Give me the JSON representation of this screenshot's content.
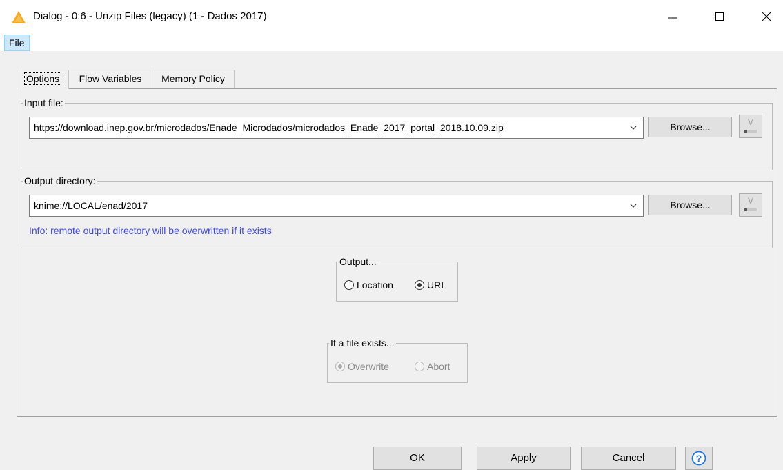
{
  "window": {
    "title": "Dialog - 0:6 - Unzip Files (legacy) (1 - Dados 2017)",
    "warning_icon": "warning-triangle-icon",
    "controls": [
      "minimize-icon",
      "maximize-icon",
      "close-icon"
    ]
  },
  "menu": {
    "file": "File"
  },
  "tabs": [
    {
      "label": "Options",
      "active": true
    },
    {
      "label": "Flow Variables",
      "active": false
    },
    {
      "label": "Memory Policy",
      "active": false
    }
  ],
  "input_file": {
    "legend": "Input file:",
    "value": "https://download.inep.gov.br/microdados/Enade_Microdados/microdados_Enade_2017_portal_2018.10.09.zip",
    "browse": "Browse..."
  },
  "output_directory": {
    "legend": "Output directory:",
    "value": "knime://LOCAL/enad/2017",
    "browse": "Browse...",
    "info": "Info: remote output directory will be overwritten if it exists"
  },
  "output_group": {
    "legend": "Output...",
    "options": [
      {
        "label": "Location",
        "selected": false
      },
      {
        "label": "URI",
        "selected": true
      }
    ]
  },
  "file_exists_group": {
    "legend": "If a file exists...",
    "enabled": false,
    "options": [
      {
        "label": "Overwrite",
        "selected": true
      },
      {
        "label": "Abort",
        "selected": false
      }
    ]
  },
  "footer": {
    "ok": "OK",
    "apply": "Apply",
    "cancel": "Cancel",
    "help_icon": "help-question-icon"
  },
  "colors": {
    "info_text": "#3d48ff",
    "warning": "#f5a623",
    "help": "#1a73e8"
  }
}
